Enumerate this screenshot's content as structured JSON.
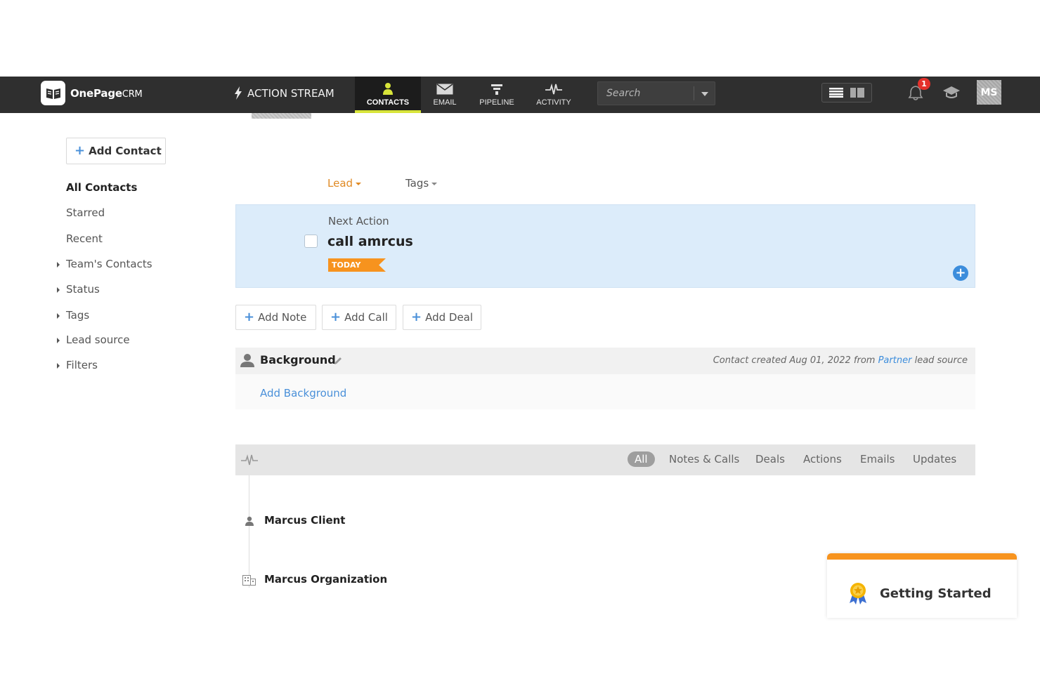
{
  "nav": {
    "brand_bold": "OnePage",
    "brand_light": "CRM",
    "action_stream": "ACTION STREAM",
    "tabs": [
      {
        "label": "CONTACTS",
        "icon": "user-icon"
      },
      {
        "label": "EMAIL",
        "icon": "envelope-icon"
      },
      {
        "label": "PIPELINE",
        "icon": "funnel-icon"
      },
      {
        "label": "ACTIVITY",
        "icon": "pulse-icon"
      }
    ],
    "search_placeholder": "Search",
    "notification_count": "1",
    "avatar_initials": "MS"
  },
  "sidebar": {
    "add_contact": "Add Contact",
    "items": [
      {
        "label": "All Contacts",
        "expandable": false
      },
      {
        "label": "Starred",
        "expandable": false
      },
      {
        "label": "Recent",
        "expandable": false
      },
      {
        "label": "Team's Contacts",
        "expandable": true
      },
      {
        "label": "Status",
        "expandable": true
      },
      {
        "label": "Tags",
        "expandable": true
      },
      {
        "label": "Lead source",
        "expandable": true
      },
      {
        "label": "Filters",
        "expandable": true
      }
    ]
  },
  "contact": {
    "status": "Lead",
    "tags": "Tags",
    "next_action_label": "Next Action",
    "next_action_title": "call amrcus",
    "next_action_due": "TODAY",
    "buttons": {
      "add_note": "Add Note",
      "add_call": "Add Call",
      "add_deal": "Add Deal"
    },
    "background_title": "Background",
    "created_prefix": "Contact created Aug 01, 2022 from",
    "created_source": "Partner",
    "created_suffix": "lead source",
    "add_background": "Add Background"
  },
  "stream": {
    "filters": [
      "All",
      "Notes & Calls",
      "Deals",
      "Actions",
      "Emails",
      "Updates"
    ],
    "active_filter": "All",
    "items": [
      {
        "label": "Marcus Client",
        "icon": "person-icon"
      },
      {
        "label": "Marcus Organization",
        "icon": "building-icon"
      }
    ]
  },
  "getting_started": {
    "title": "Getting Started"
  },
  "colors": {
    "nav_bg": "#2f2f2f",
    "active_underline": "#d8e53a",
    "accent": "#f7931e",
    "link": "#3c8ddc",
    "next_action_bg": "#dcecfa"
  }
}
